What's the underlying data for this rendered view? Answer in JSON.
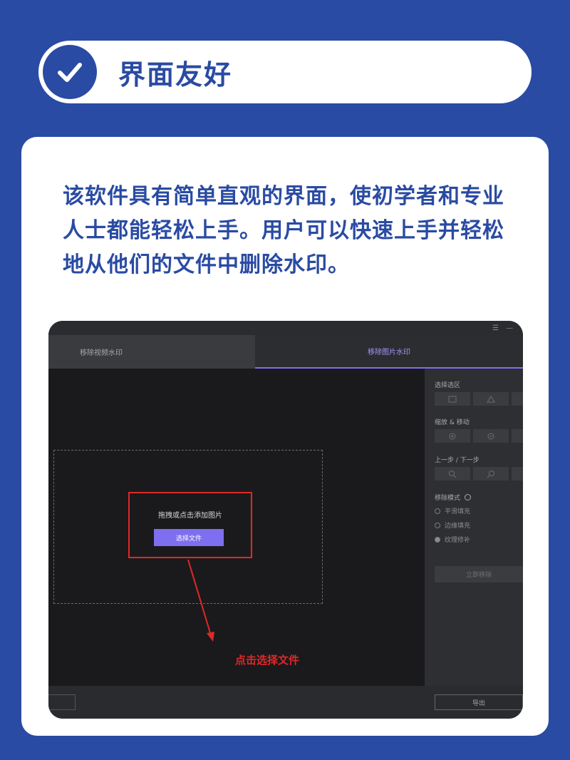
{
  "header": {
    "title": "界面友好",
    "icon": "check-icon"
  },
  "card": {
    "description": "该软件具有简单直观的界面，使初学者和专业人士都能轻松上手。用户可以快速上手并轻松地从他们的文件中删除水印。"
  },
  "app": {
    "tabs": [
      {
        "label": "移除视频水印",
        "active": false
      },
      {
        "label": "移除图片水印",
        "active": true
      }
    ],
    "window_controls": {
      "menu": "☰",
      "minimize": "—"
    },
    "drop_zone": {
      "prompt": "拖拽或点击添加图片",
      "choose_button": "选择文件",
      "hint": "点击选择文件"
    },
    "panel": {
      "select_area_label": "选择选区",
      "zoom_move_label": "缩放 & 移动",
      "undo_redo_label": "上一步 / 下一步",
      "remove_mode_label": "移除模式",
      "remove_modes": [
        {
          "label": "平滑填充",
          "selected": false
        },
        {
          "label": "边缘填充",
          "selected": false
        },
        {
          "label": "纹理修补",
          "selected": true
        }
      ],
      "remove_button": "立即移除"
    },
    "export_button": "导出"
  },
  "colors": {
    "brand_blue": "#2a4ba3",
    "accent_purple": "#7e6ef0",
    "annotation_red": "#e02828"
  }
}
